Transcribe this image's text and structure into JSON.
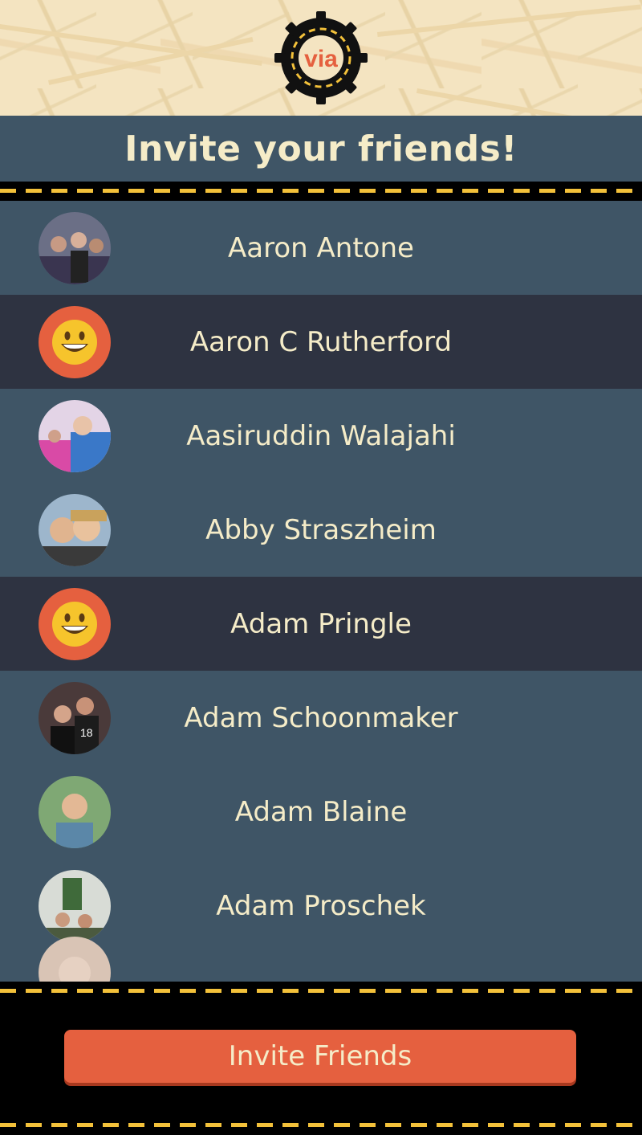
{
  "app": {
    "logo_text": "via"
  },
  "header": {
    "title": "Invite your friends!"
  },
  "friends": [
    {
      "name": "Aaron Antone",
      "avatar": "photo"
    },
    {
      "name": "Aaron C Rutherford",
      "avatar": "smiley"
    },
    {
      "name": "Aasiruddin Walajahi",
      "avatar": "photo"
    },
    {
      "name": "Abby Straszheim",
      "avatar": "photo"
    },
    {
      "name": "Adam Pringle",
      "avatar": "smiley"
    },
    {
      "name": "Adam Schoonmaker",
      "avatar": "photo"
    },
    {
      "name": "Adam Blaine",
      "avatar": "photo"
    },
    {
      "name": "Adam Proschek",
      "avatar": "photo"
    },
    {
      "name": "",
      "avatar": "photo"
    }
  ],
  "footer": {
    "invite_label": "Invite Friends"
  },
  "colors": {
    "accent": "#e5603f",
    "row_light": "#3f5566",
    "row_dark": "#2e3341",
    "text": "#f5ecc8",
    "dash": "#f3c13a"
  }
}
